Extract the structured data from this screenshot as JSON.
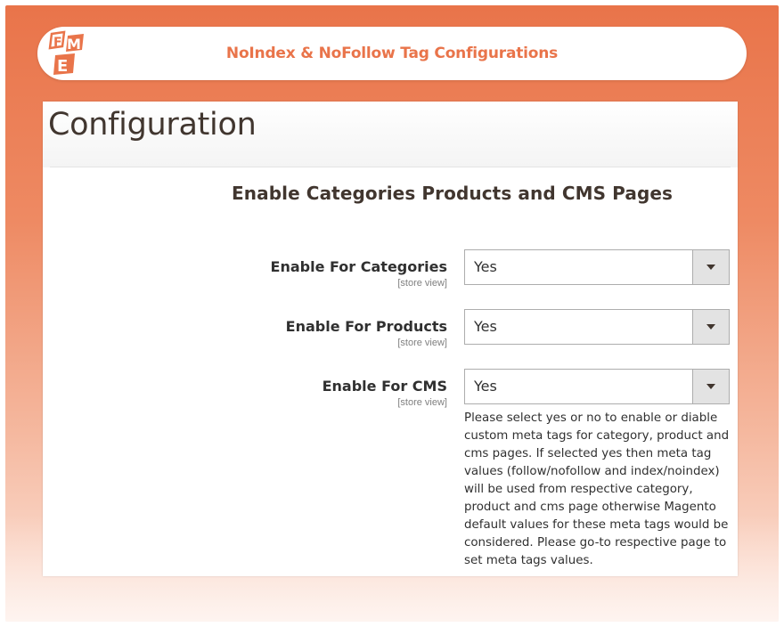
{
  "header": {
    "title": "NoIndex & NoFollow Tag Configurations",
    "logo_text": "FME",
    "logo_color": "#e9744a"
  },
  "page": {
    "title": "Configuration"
  },
  "section": {
    "title": "Enable Categories Products and CMS Pages"
  },
  "fields": [
    {
      "label": "Enable For Categories",
      "scope": "[store view]",
      "value": "Yes"
    },
    {
      "label": "Enable For Products",
      "scope": "[store view]",
      "value": "Yes"
    },
    {
      "label": "Enable For CMS",
      "scope": "[store view]",
      "value": "Yes"
    }
  ],
  "note": "Please select yes or no to enable or diable custom meta tags for category, product and cms pages. If selected yes then meta tag values (follow/nofollow and index/noindex) will be used from respective category, product and cms page otherwise Magento default values for these meta tags would be considered. Please go-to respective page to set meta tags values.",
  "colors": {
    "accent": "#e9744a",
    "text": "#303030",
    "title": "#41362f"
  }
}
